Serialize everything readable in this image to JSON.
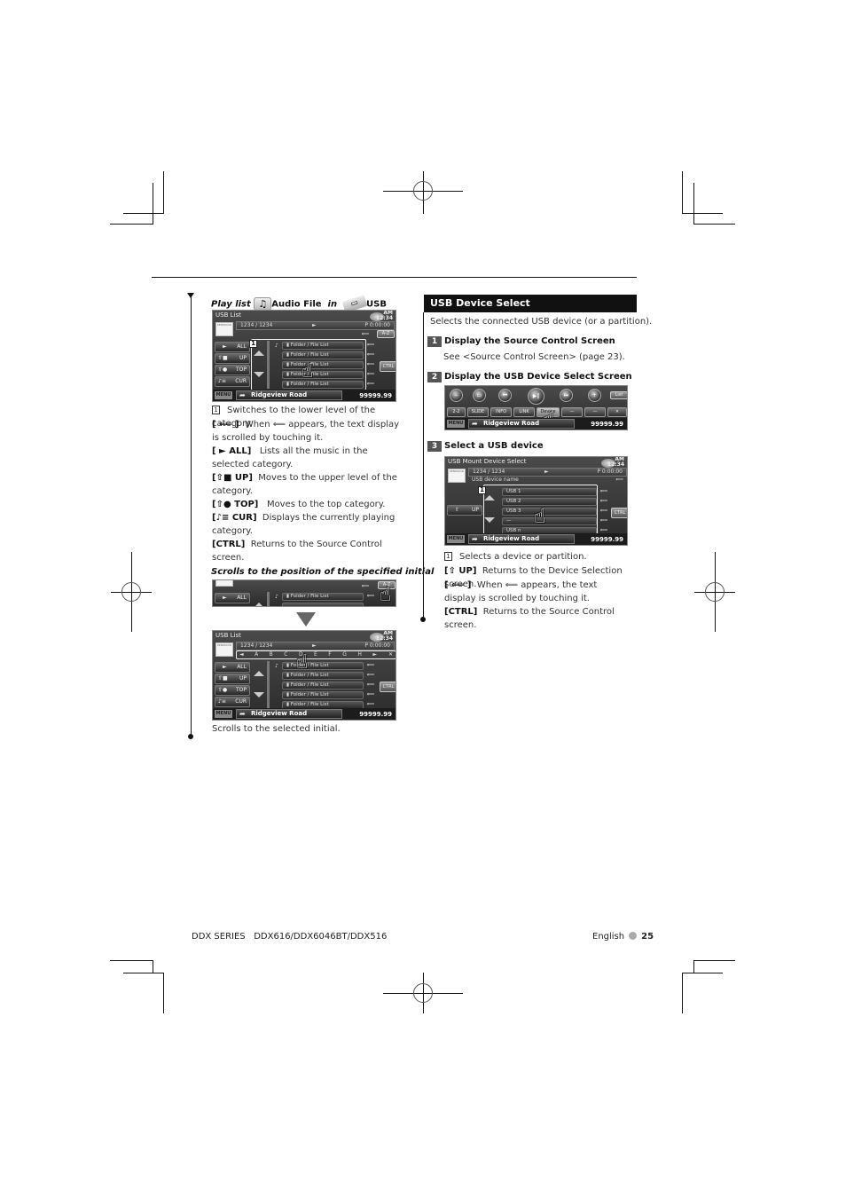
{
  "left_column": {
    "play_list_heading": {
      "prefix": "Play list",
      "audio_label": "Audio File",
      "in_label": "in",
      "usb_label": "USB"
    },
    "screen1": {
      "title": "USB List",
      "clock_ampm": "AM",
      "clock_time": "12:34",
      "track_info": "1234 / 1234",
      "play_glyph": "►",
      "time": "P 0:00:00",
      "az_button": "A-Z",
      "scroll_glyph": "⟸",
      "side_buttons": [
        "ALL",
        "UP",
        "TOP",
        "CUR"
      ],
      "list_items": [
        "Folder / File List",
        "Folder / File List",
        "Folder / File List",
        "Folder / File List",
        "Folder / File List"
      ],
      "callout": "1",
      "ctrl": "CTRL",
      "menu": "MENU",
      "road": "Ridgeview Road",
      "distance": "99999.99"
    },
    "descriptions": [
      {
        "key": "1",
        "text": "Switches to the lower level of the category."
      },
      {
        "key": "[ ⟸ ]",
        "text": "When ⟸ appears, the text display is scrolled by touching it."
      },
      {
        "key": "[ ► ALL]",
        "text": "Lists all the music in the selected category."
      },
      {
        "key": "[⇧■ UP]",
        "text": "Moves to the upper level of the category."
      },
      {
        "key": "[⇧● TOP]",
        "text": "Moves to the top category."
      },
      {
        "key": "[♪≡ CUR]",
        "text": "Displays the currently playing category."
      },
      {
        "key": "[CTRL]",
        "text": "Returns to the Source Control screen."
      }
    ],
    "scroll_heading": "Scrolls to the position of the specified initial",
    "screen2": {
      "side_button": "ALL",
      "list_item": "Folder / File List",
      "az_button": "A-Z"
    },
    "screen3": {
      "title": "USB List",
      "clock_ampm": "AM",
      "clock_time": "12:34",
      "track_info": "1234 / 1234",
      "time": "P 0:00:00",
      "initials": [
        "◄",
        "A",
        "B",
        "C",
        "D",
        "E",
        "F",
        "G",
        "H",
        "►"
      ],
      "close_glyph": "✕",
      "side_buttons": [
        "ALL",
        "UP",
        "TOP",
        "CUR"
      ],
      "list_items": [
        "Folder / File List",
        "Folder / File List",
        "Folder / File List",
        "Folder / File List",
        "Folder / File List"
      ],
      "ctrl": "CTRL",
      "menu": "MENU",
      "road": "Ridgeview Road",
      "distance": "99999.99"
    },
    "scroll_caption": "Scrolls to the selected initial."
  },
  "right_column": {
    "section_title": "USB Device Select",
    "intro": "Selects the connected USB device (or a partition).",
    "steps": [
      {
        "num": "1",
        "title": "Display the Source Control Screen",
        "detail": "See <Source Control Screen> (page 23)."
      },
      {
        "num": "2",
        "title": "Display the USB Device Select Screen"
      },
      {
        "num": "3",
        "title": "Select a USB device"
      }
    ],
    "control_screen": {
      "round_buttons": [
        "−",
        "▭",
        "⏮",
        "▶‖",
        "⏭",
        "+"
      ],
      "list_button": "List",
      "tabs": [
        "2-2",
        "SLIDE",
        "INFO",
        "LINK",
        "Device",
        "—",
        "—",
        "✕"
      ],
      "menu": "MENU",
      "road": "Ridgeview Road",
      "distance": "99999.99"
    },
    "device_screen": {
      "title": "USB Mount Device Select",
      "clock_ampm": "AM",
      "clock_time": "12:34",
      "track_info": "1234 / 1234",
      "play_glyph": "►",
      "time": "P 0:00:00",
      "device_name": "USB device name",
      "callout": "1",
      "up_button": "UP",
      "devices": [
        "USB 1",
        "USB 2",
        "USB 3",
        "—",
        "USB n"
      ],
      "ctrl": "CTRL",
      "menu": "MENU",
      "road": "Ridgeview Road",
      "distance": "99999.99"
    },
    "descriptions": [
      {
        "key": "1",
        "text": "Selects a device or partition."
      },
      {
        "key": "[⇧ UP]",
        "text": "Returns to the Device Selection screen."
      },
      {
        "key": "[ ⟸ ]",
        "text": "When ⟸ appears, the text display is scrolled by touching it."
      },
      {
        "key": "[CTRL]",
        "text": "Returns to the Source Control screen."
      }
    ]
  },
  "footer": {
    "series": "DDX SERIES",
    "models": "DDX616/DDX6046BT/DDX516",
    "language": "English",
    "page_number": "25"
  }
}
